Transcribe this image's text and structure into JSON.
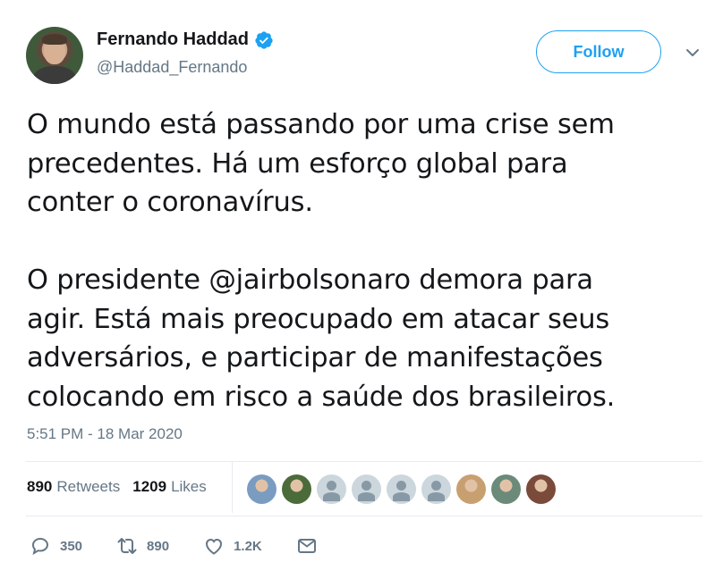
{
  "author": {
    "display_name": "Fernando Haddad",
    "handle": "@Haddad_Fernando",
    "verified": true
  },
  "follow_label": "Follow",
  "tweet": {
    "paragraph_1": "O mundo está passando por uma crise sem\nprecedentes. Há um esforço global para\nconter o coronavírus.",
    "paragraph_2": "O presidente @jairbolsonaro demora para\nagir. Está mais preocupado em atacar seus\nadversários, e participar de manifestações\ncolocando em risco a saúde dos brasileiros."
  },
  "timestamp": "5:51 PM - 18 Mar 2020",
  "stats": {
    "retweets_count": "890",
    "retweets_label": "Retweets",
    "likes_count": "1209",
    "likes_label": "Likes"
  },
  "likers": [
    {
      "name": "liker-avatar-1",
      "color": "#7a9cc0"
    },
    {
      "name": "liker-avatar-2",
      "color": "#4b6b3a"
    },
    {
      "name": "liker-avatar-default-1"
    },
    {
      "name": "liker-avatar-default-2"
    },
    {
      "name": "liker-avatar-default-3"
    },
    {
      "name": "liker-avatar-default-4"
    },
    {
      "name": "liker-avatar-3",
      "color": "#c8a070"
    },
    {
      "name": "liker-avatar-4",
      "color": "#6b8a7a"
    },
    {
      "name": "liker-avatar-5",
      "color": "#7a4a3a"
    }
  ],
  "actions": {
    "reply_count": "350",
    "retweet_count": "890",
    "like_count": "1.2K"
  },
  "colors": {
    "accent": "#1da1f2",
    "text": "#14171a",
    "secondary": "#657786",
    "border": "#e6ecf0"
  }
}
